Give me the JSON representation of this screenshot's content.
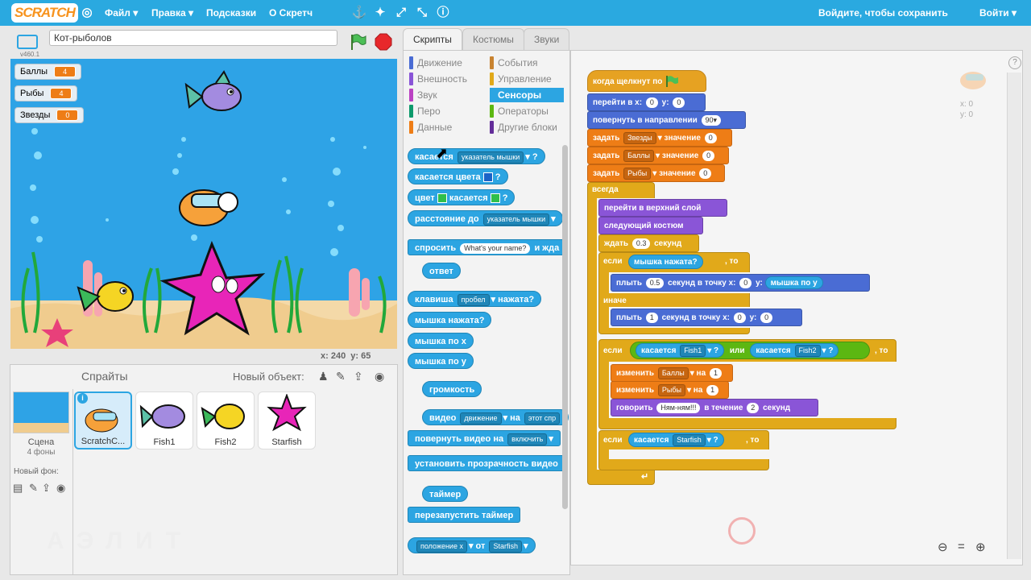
{
  "topbar": {
    "logo": "SCRATCH",
    "menu": [
      "Файл ▾",
      "Правка ▾",
      "Подсказки",
      "О Скретч"
    ],
    "save_prompt": "Войдите, чтобы сохранить",
    "login": "Войти ▾"
  },
  "project": {
    "title": "Кот-рыболов",
    "version": "v460.1",
    "coords": "x: 240  y: 65"
  },
  "stage": {
    "vars": [
      {
        "name": "Баллы",
        "value": "4"
      },
      {
        "name": "Рыбы",
        "value": "4"
      },
      {
        "name": "Звезды",
        "value": "0"
      }
    ]
  },
  "tabs": [
    "Скрипты",
    "Костюмы",
    "Звуки"
  ],
  "categories": [
    {
      "label": "Движение",
      "color": "#4a6cd4"
    },
    {
      "label": "События",
      "color": "#c88330"
    },
    {
      "label": "Внешность",
      "color": "#8a55d7"
    },
    {
      "label": "Управление",
      "color": "#e1a91a"
    },
    {
      "label": "Звук",
      "color": "#bb42c3"
    },
    {
      "label": "Сенсоры",
      "color": "#2ca5e2"
    },
    {
      "label": "Перо",
      "color": "#0e9a6c"
    },
    {
      "label": "Операторы",
      "color": "#5cb712"
    },
    {
      "label": "Данные",
      "color": "#ee7d16"
    },
    {
      "label": "Другие блоки",
      "color": "#632d99"
    }
  ],
  "palette": {
    "touching": "касается",
    "touching_dd": "указатель мышки",
    "touching_color": "касается цвета",
    "color": "цвет",
    "color_touching": "касается",
    "distance": "расстояние до",
    "distance_dd": "указатель мышки",
    "ask": "спросить",
    "ask_input": "What's your name?",
    "ask_wait": "и жда",
    "answer": "ответ",
    "key": "клавиша",
    "key_dd": "пробел",
    "key_pressed": "нажата?",
    "mouse_down": "мышка нажата?",
    "mouse_x": "мышка по х",
    "mouse_y": "мышка по у",
    "loudness": "громкость",
    "video": "видео",
    "video_dd": "движение",
    "video_on": "на",
    "video_dd2": "этот спр",
    "turn_video": "повернуть видео на",
    "turn_video_dd": "включить",
    "transparency": "установить прозрачность видео",
    "timer": "таймер",
    "reset_timer": "перезапустить таймер",
    "position": "положение x",
    "position_of": "от",
    "position_dd": "Starfish",
    "q": "?"
  },
  "script": {
    "when_flag": "когда щелкнут по",
    "goto": "перейти в х:",
    "goto_x": "0",
    "goto_y_label": "y:",
    "goto_y": "0",
    "point": "повернуть в направлении",
    "point_val": "90▾",
    "set": "задать",
    "set1_dd": "Звезды",
    "set2_dd": "Баллы",
    "set3_dd": "Рыбы",
    "set_value": "значение",
    "set_val": "0",
    "forever": "всегда",
    "front": "перейти в верхний слой",
    "next_costume": "следующий костюм",
    "wait": "ждать",
    "wait_val": "0.3",
    "seconds": "секунд",
    "if": "если",
    "mouse_down": "мышка нажата?",
    "then": ", то",
    "glide": "плыть",
    "glide1_val": "0.5",
    "glide_sec": "секунд в точку х:",
    "glide1_x": "0",
    "glide_y": "у:",
    "glide1_y_block": "мышка по у",
    "else": "иначе",
    "glide2_val": "1",
    "glide2_x": "0",
    "glide2_y": "0",
    "touching": "касается",
    "touch1_dd": "Fish1",
    "or": "или",
    "touch2_dd": "Fish2",
    "q": "?",
    "change": "изменить",
    "change1_dd": "Баллы",
    "change2_dd": "Рыбы",
    "by": "на",
    "change_val": "1",
    "say": "говорить",
    "say_text": "Ням-ням!!!",
    "say_for": "в течение",
    "say_val": "2",
    "say_sec": "секунд",
    "touch3_dd": "Starfish",
    "sprite_x": "x: 0",
    "sprite_y": "y: 0"
  },
  "sprites_panel": {
    "title": "Спрайты",
    "new_object": "Новый объект:",
    "scene_label": "Сцена",
    "scene_count": "4 фоны",
    "new_backdrop": "Новый фон:",
    "sprites": [
      "ScratchC...",
      "Fish1",
      "Fish2",
      "Starfish"
    ]
  },
  "watermark": "АЭЛИТ"
}
